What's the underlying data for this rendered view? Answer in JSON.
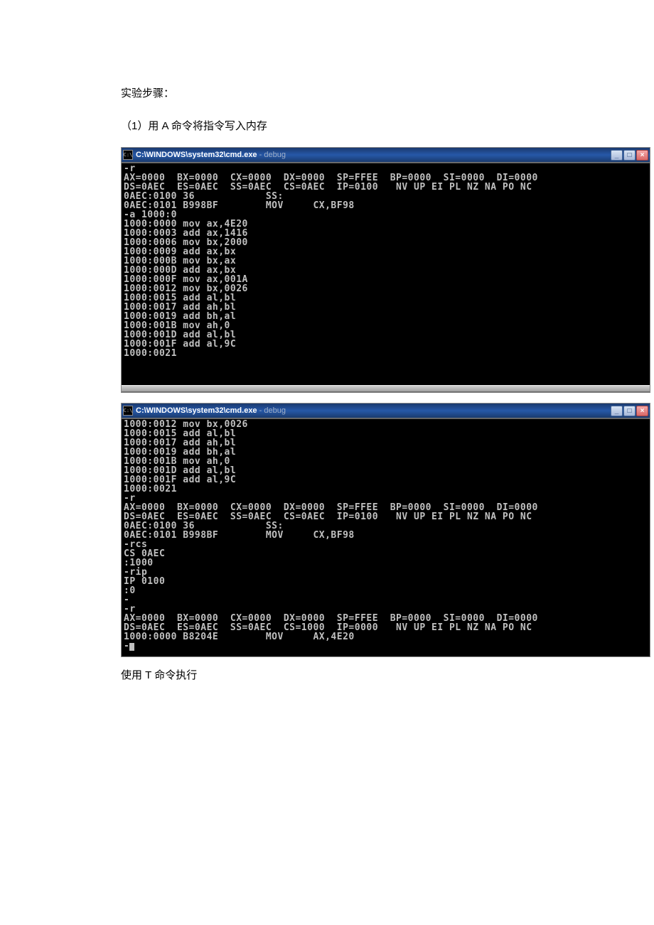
{
  "doc": {
    "steps_label": "实验步骤：",
    "step1": "（1）用 A 命令将指令写入内存",
    "footer": "使用 T 命令执行"
  },
  "window1": {
    "icon_text": "C:\\",
    "title_white": "C:\\WINDOWS\\system32\\cmd.exe",
    "title_sep": " - ",
    "title_gray": "debug",
    "min": "_",
    "max": "□",
    "close": "×",
    "lines": [
      "-r",
      "AX=0000  BX=0000  CX=0000  DX=0000  SP=FFEE  BP=0000  SI=0000  DI=0000",
      "DS=0AEC  ES=0AEC  SS=0AEC  CS=0AEC  IP=0100   NV UP EI PL NZ NA PO NC",
      "0AEC:0100 36            SS:",
      "0AEC:0101 B998BF        MOV     CX,BF98",
      "-a 1000:0",
      "1000:0000 mov ax,4E20",
      "1000:0003 add ax,1416",
      "1000:0006 mov bx,2000",
      "1000:0009 add ax,bx",
      "1000:000B mov bx,ax",
      "1000:000D add ax,bx",
      "1000:000F mov ax,001A",
      "1000:0012 mov bx,0026",
      "1000:0015 add al,bl",
      "1000:0017 add ah,bl",
      "1000:0019 add bh,al",
      "1000:001B mov ah,0",
      "1000:001D add al,bl",
      "1000:001F add al,9C",
      "1000:0021",
      " ",
      " "
    ]
  },
  "window2": {
    "icon_text": "C:\\",
    "title_white": "C:\\WINDOWS\\system32\\cmd.exe",
    "title_sep": " - ",
    "title_gray": "debug",
    "min": "_",
    "max": "□",
    "close": "×",
    "lines": [
      "1000:0012 mov bx,0026",
      "1000:0015 add al,bl",
      "1000:0017 add ah,bl",
      "1000:0019 add bh,al",
      "1000:001B mov ah,0",
      "1000:001D add al,bl",
      "1000:001F add al,9C",
      "1000:0021",
      "-r",
      "AX=0000  BX=0000  CX=0000  DX=0000  SP=FFEE  BP=0000  SI=0000  DI=0000",
      "DS=0AEC  ES=0AEC  SS=0AEC  CS=0AEC  IP=0100   NV UP EI PL NZ NA PO NC",
      "0AEC:0100 36            SS:",
      "0AEC:0101 B998BF        MOV     CX,BF98",
      "-rcs",
      "CS 0AEC",
      ":1000",
      "-rip",
      "IP 0100",
      ":0",
      "-",
      "-r",
      "AX=0000  BX=0000  CX=0000  DX=0000  SP=FFEE  BP=0000  SI=0000  DI=0000",
      "DS=0AEC  ES=0AEC  SS=0AEC  CS=1000  IP=0000   NV UP EI PL NZ NA PO NC",
      "1000:0000 B8204E        MOV     AX,4E20"
    ],
    "cursor_line": "-"
  }
}
